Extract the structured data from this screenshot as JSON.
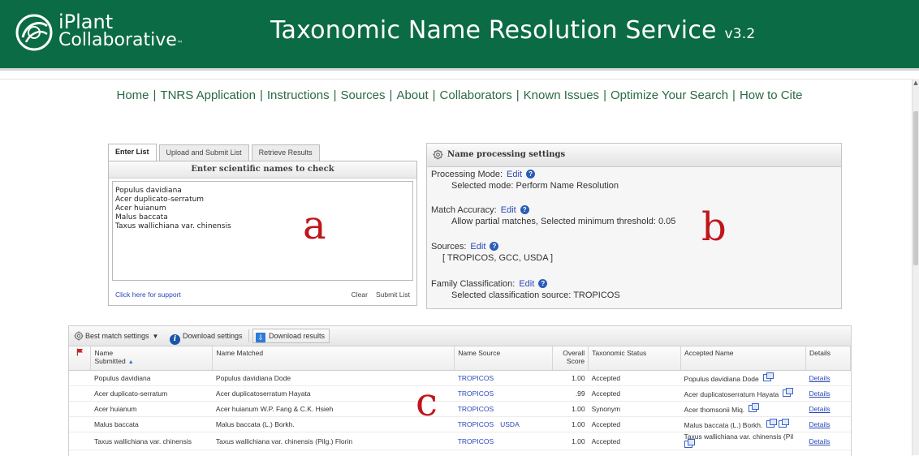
{
  "header": {
    "logo_line1": "iPlant",
    "logo_line2": "Collaborative",
    "logo_tm": "™",
    "title": "Taxonomic Name Resolution Service",
    "version": "v3.2",
    "brand_color": "#0b6b45"
  },
  "nav": {
    "items": [
      "Home",
      "TNRS Application",
      "Instructions",
      "Sources",
      "About",
      "Collaborators",
      "Known Issues",
      "Optimize Your Search",
      "How to Cite"
    ],
    "separator": "|"
  },
  "input_panel": {
    "tabs": [
      "Enter List",
      "Upload and Submit List",
      "Retrieve Results"
    ],
    "active_tab": 0,
    "heading": "Enter scientific names to check",
    "names": [
      "Populus davidiana",
      "Acer duplicato-serratum",
      "Acer huianum",
      "Malus baccata",
      "Taxus wallichiana var. chinensis"
    ],
    "support_link": "Click here for support",
    "clear_label": "Clear",
    "submit_label": "Submit List",
    "annotation": "a"
  },
  "settings_panel": {
    "title": "Name processing settings",
    "edit_label": "Edit",
    "processing_mode_label": "Processing Mode:",
    "processing_mode_value": "Selected mode:   Perform Name Resolution",
    "match_accuracy_label": "Match Accuracy:",
    "match_accuracy_value": "Allow partial matches, Selected minimum threshold: 0.05",
    "sources_label": "Sources:",
    "sources_value": "[ TROPICOS, GCC, USDA ]",
    "family_label": "Family Classification:",
    "family_value": "Selected classification source: TROPICOS",
    "annotation": "b"
  },
  "results": {
    "toolbar": {
      "best_match": "Best match settings",
      "download_settings": "Download settings",
      "download_results": "Download results"
    },
    "columns": {
      "name_submitted_line1": "Name",
      "name_submitted_line2": "Submitted",
      "name_matched": "Name Matched",
      "name_source": "Name Source",
      "overall_score_line1": "Overall",
      "overall_score_line2": "Score",
      "taxonomic_status": "Taxonomic Status",
      "accepted_name": "Accepted Name",
      "details": "Details"
    },
    "rows": [
      {
        "submitted": "Populus davidiana",
        "matched": "Populus davidiana Dode",
        "sources": [
          "TROPICOS"
        ],
        "score": "1.00",
        "status": "Accepted",
        "accepted": "Populus davidiana Dode",
        "details": "Details"
      },
      {
        "submitted": "Acer duplicato-serratum",
        "matched": "Acer duplicatoserratum Hayata",
        "sources": [
          "TROPICOS"
        ],
        "score": ".99",
        "status": "Accepted",
        "accepted": "Acer duplicatoserratum Hayata",
        "details": "Details"
      },
      {
        "submitted": "Acer huianum",
        "matched": "Acer huianum W.P. Fang & C.K. Hsieh",
        "sources": [
          "TROPICOS"
        ],
        "score": "1.00",
        "status": "Synonym",
        "accepted": "Acer thomsonii Miq.",
        "details": "Details"
      },
      {
        "submitted": "Malus baccata",
        "matched": "Malus baccata (L.) Borkh.",
        "sources": [
          "TROPICOS",
          "USDA"
        ],
        "score": "1.00",
        "status": "Accepted",
        "accepted": "Malus baccata (L.) Borkh.",
        "details": "Details"
      },
      {
        "submitted": "Taxus wallichiana var. chinensis",
        "matched": "Taxus wallichiana var. chinensis (Pilg.) Florin",
        "sources": [
          "TROPICOS"
        ],
        "score": "1.00",
        "status": "Accepted",
        "accepted": "Taxus wallichiana var. chinensis (Pil",
        "details": "Details"
      }
    ],
    "annotation": "c",
    "link_color": "#2b47b8"
  },
  "annotation_color": "#c0151c"
}
